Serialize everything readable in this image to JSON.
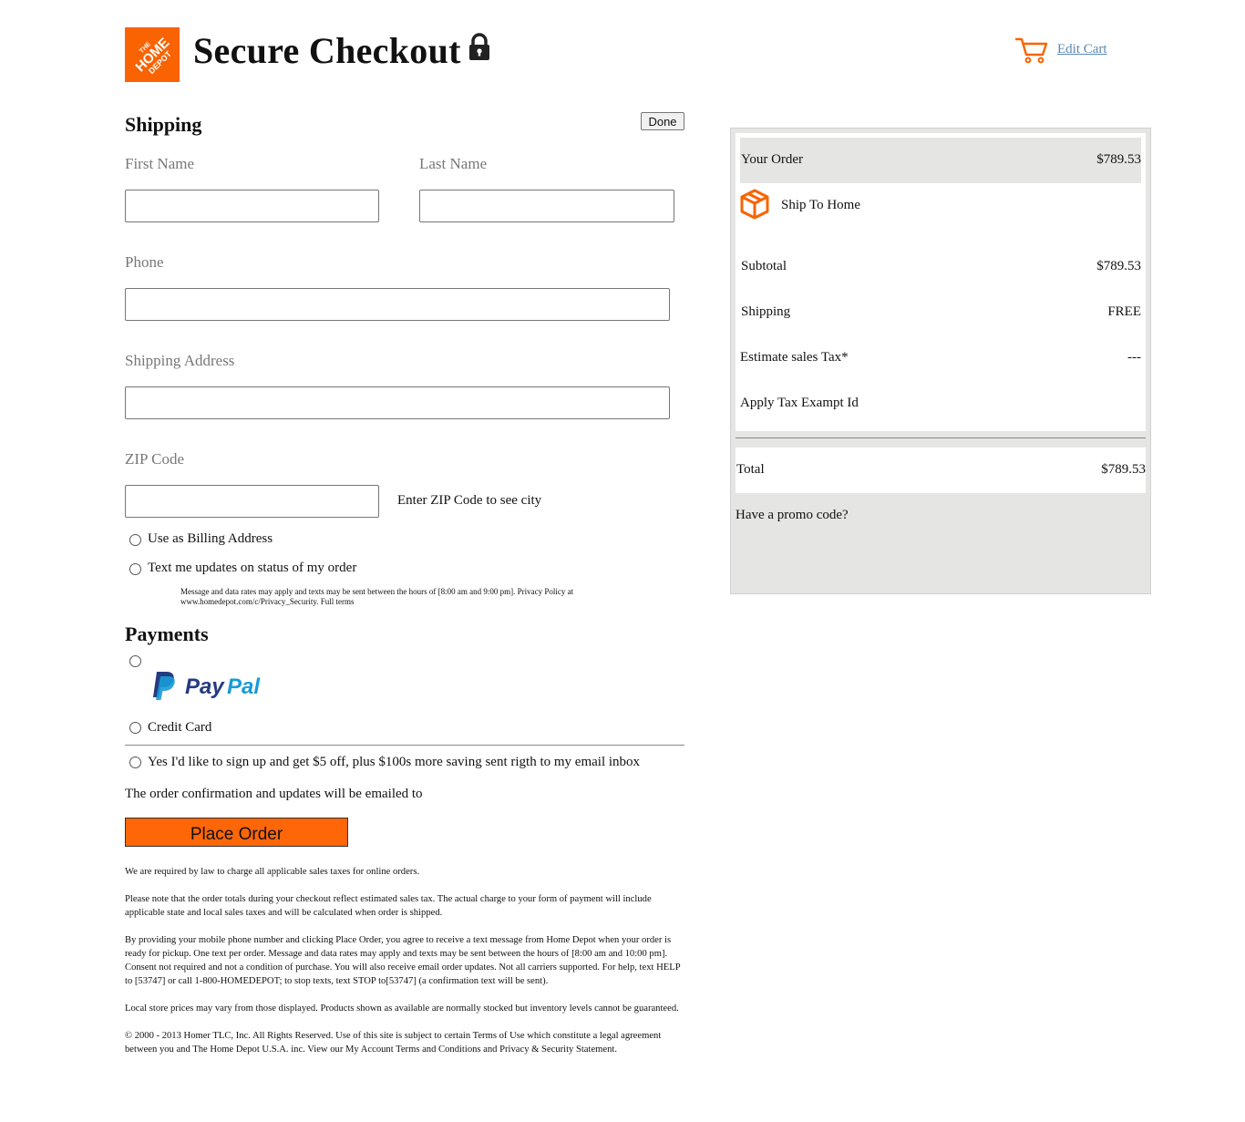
{
  "header": {
    "brand": "THE HOME DEPOT",
    "title": "Secure Checkout",
    "edit_cart": "Edit Cart"
  },
  "shipping": {
    "title": "Shipping",
    "done": "Done",
    "first_name": {
      "label": "First Name",
      "value": ""
    },
    "last_name": {
      "label": "Last Name",
      "value": ""
    },
    "phone": {
      "label": "Phone",
      "value": ""
    },
    "address": {
      "label": "Shipping Address",
      "value": ""
    },
    "zip": {
      "label": "ZIP Code",
      "value": "",
      "hint": "Enter ZIP Code to see city"
    },
    "billing_option": "Use as Billing Address",
    "text_updates_option": "Text me updates on status of my order",
    "sms_fine_print": "Message and data rates may apply and texts may be sent between the hours of [8:00 am and 9:00 pm]. Privacy Policy at www.homedepot.com/c/Privacy_Security. Full terms"
  },
  "payments": {
    "title": "Payments",
    "paypal": "PayPal",
    "credit_card": "Credit Card",
    "signup_offer": "Yes I'd like to sign up and get $5 off, plus $100s more saving sent rigth to my email inbox",
    "confirmation_text": "The order confirmation and updates will be emailed to",
    "place_order": "Place Order"
  },
  "legal": [
    "We are required by law to charge all applicable sales taxes for online orders.",
    "Please note that the order totals during your checkout reflect estimated sales tax. The actual charge to your form of payment will include applicable state and local sales taxes and will be calculated when order is shipped.",
    "By providing your mobile phone number and clicking Place Order, you agree to receive a text message from Home Depot when your order is ready for pickup. One text per order. Message and data rates may apply and texts may be sent between the hours of [8:00 am and 10:00 pm]. Consent not required and not a condition of purchase. You will also receive email order updates. Not all carriers supported. For help, text HELP to [53747] or call 1-800-HOMEDEPOT; to stop texts, text STOP to[53747] (a confirmation text will be sent).",
    "Local store prices may vary from those displayed. Products shown as available are normally stocked but inventory levels cannot be guaranteed.",
    "© 2000 - 2013 Homer TLC, Inc. All Rights Reserved. Use of this site is subject to certain Terms of Use which constitute a legal agreement between you and The Home Depot U.S.A. inc. View our My Account Terms and Conditions and Privacy & Security Statement."
  ],
  "summary": {
    "your_order": {
      "label": "Your Order",
      "value": "$789.53"
    },
    "ship_to_home": "Ship To Home",
    "subtotal": {
      "label": "Subtotal",
      "value": "$789.53"
    },
    "shipping": {
      "label": "Shipping",
      "value": "FREE"
    },
    "tax": {
      "label": "Estimate sales Tax*",
      "value": "---"
    },
    "tax_exempt": "Apply Tax Exampt Id",
    "total": {
      "label": "Total",
      "value": "$789.53"
    },
    "promo": "Have a promo code?"
  },
  "colors": {
    "brand_orange": "#f96302",
    "button_orange": "#fe6608",
    "link_blue": "#5b89b5",
    "panel_gray": "#e5e5e4"
  },
  "icons": [
    "home-depot-logo",
    "lock-icon",
    "cart-icon",
    "box-icon",
    "paypal-logo"
  ]
}
